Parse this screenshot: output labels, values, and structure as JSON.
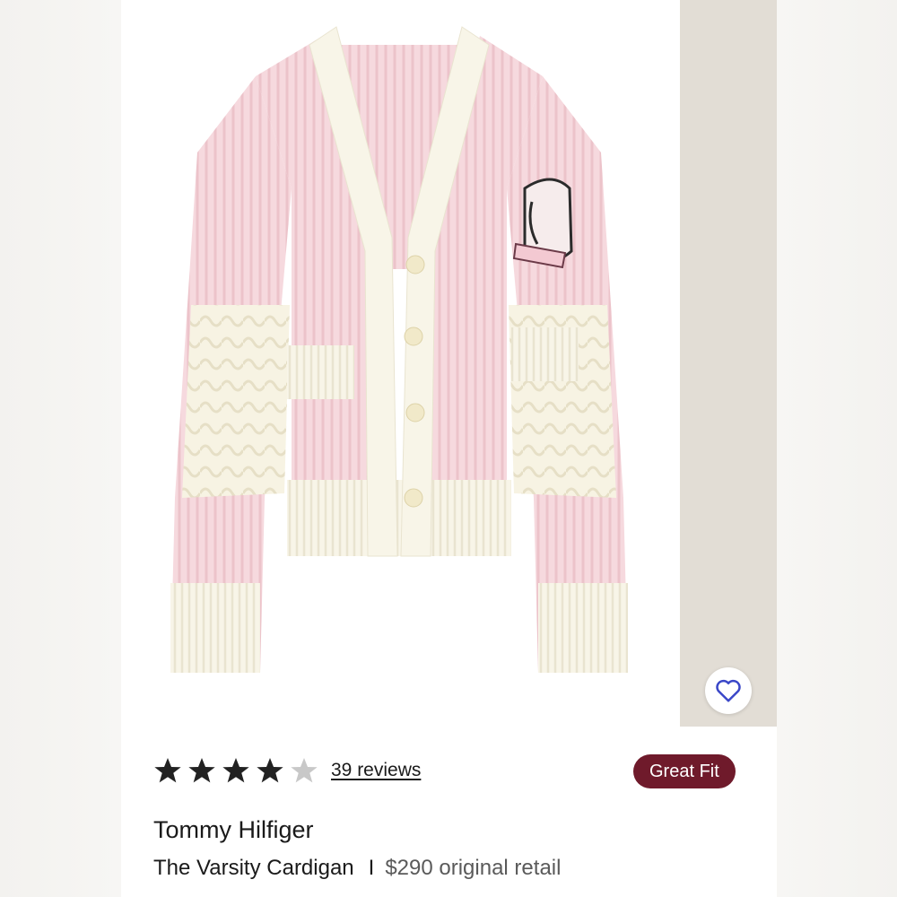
{
  "product": {
    "brand": "Tommy Hilfiger",
    "name": "The Varsity Cardigan",
    "divider": "I",
    "price_text": "$290 original retail",
    "image_alt": "Pink and cream ribbed knit varsity cardigan with crest patch"
  },
  "rating": {
    "stars_filled": 4,
    "stars_total": 5,
    "reviews_text": "39 reviews"
  },
  "badge": {
    "label": "Great Fit"
  },
  "favorite": {
    "icon": "heart-outline-icon"
  },
  "colors": {
    "badge": "#6f1a2b",
    "star_filled": "#222222",
    "star_empty": "#c8c8c8",
    "heart": "#3a47c8",
    "cardigan_pink": "#f6d9de",
    "cardigan_cream": "#f8f5e8"
  }
}
